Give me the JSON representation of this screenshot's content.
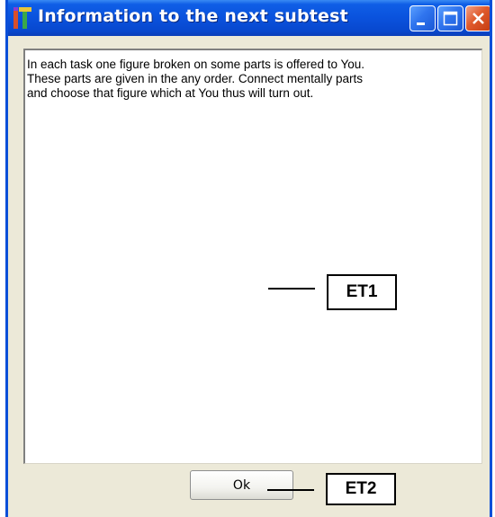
{
  "window": {
    "title": "Information to the next subtest",
    "controls": [
      "minimize",
      "maximize",
      "close"
    ]
  },
  "content": {
    "text": "In each task one figure broken on some parts is offered to You.\nThese parts are given in the any order. Connect mentally parts\nand choose that figure which at You thus will turn out."
  },
  "buttons": {
    "ok_label": "Ok"
  },
  "callouts": {
    "et1": "ET1",
    "et2": "ET2"
  },
  "colors": {
    "titlebar": "#0a52dd",
    "window_bg": "#ece9d8",
    "close_button": "#e05a2c"
  },
  "icons": {
    "app": "app-icon",
    "minimize": "minimize-icon",
    "maximize": "maximize-icon",
    "close": "close-icon"
  }
}
